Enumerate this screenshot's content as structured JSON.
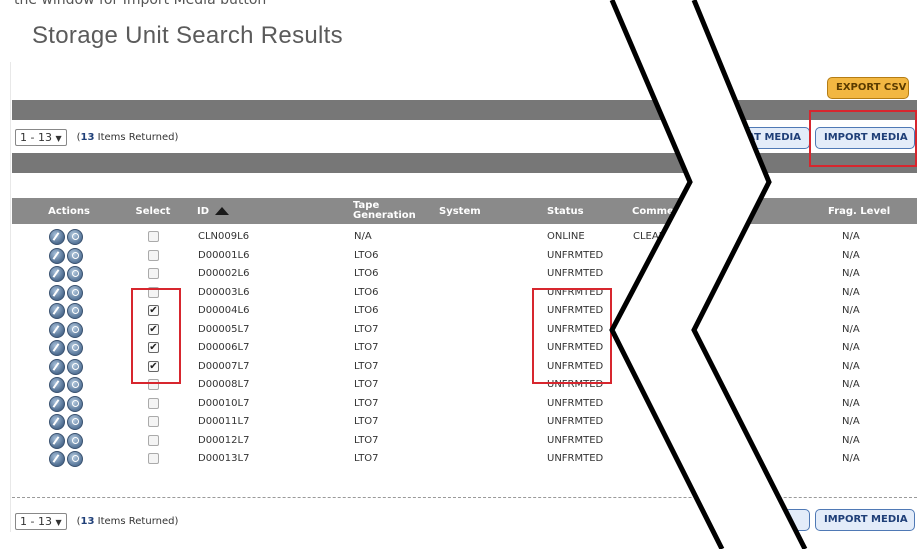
{
  "page": {
    "top_cut_text": "the window for Import Media button",
    "title": "Storage Unit Search Results"
  },
  "toolbar": {
    "export_csv": "EXPORT CSV",
    "format_media_partial": "AT MEDIA",
    "import_media": "IMPORT MEDIA"
  },
  "pager": {
    "range_label": "1 - 13",
    "arrow": "▼",
    "count_prefix": "(",
    "count": "13",
    "count_suffix": " Items Returned)"
  },
  "table": {
    "columns": {
      "actions": "Actions",
      "select": "Select",
      "id": "ID",
      "tape_generation": "Tape Generation",
      "system": "System",
      "status": "Status",
      "comments_partial": "Comme",
      "frag_level": "Frag. Level"
    },
    "sort_column": "id",
    "rows": [
      {
        "id": "CLN009L6",
        "tape_generation": "N/A",
        "system": "",
        "status": "ONLINE",
        "comments": "CLEANING",
        "frag_level": "N/A",
        "selected": false
      },
      {
        "id": "D00001L6",
        "tape_generation": "LTO6",
        "system": "",
        "status": "UNFRMTED",
        "comments": "",
        "frag_level": "N/A",
        "selected": false
      },
      {
        "id": "D00002L6",
        "tape_generation": "LTO6",
        "system": "",
        "status": "UNFRMTED",
        "comments": "",
        "frag_level": "N/A",
        "selected": false
      },
      {
        "id": "D00003L6",
        "tape_generation": "LTO6",
        "system": "",
        "status": "UNFRMTED",
        "comments": "",
        "frag_level": "N/A",
        "selected": false
      },
      {
        "id": "D00004L6",
        "tape_generation": "LTO6",
        "system": "",
        "status": "UNFRMTED",
        "comments": "",
        "frag_level": "N/A",
        "selected": true
      },
      {
        "id": "D00005L7",
        "tape_generation": "LTO7",
        "system": "",
        "status": "UNFRMTED",
        "comments": "",
        "frag_level": "N/A",
        "selected": true
      },
      {
        "id": "D00006L7",
        "tape_generation": "LTO7",
        "system": "",
        "status": "UNFRMTED",
        "comments": "",
        "frag_level": "N/A",
        "selected": true
      },
      {
        "id": "D00007L7",
        "tape_generation": "LTO7",
        "system": "",
        "status": "UNFRMTED",
        "comments": "",
        "frag_level": "N/A",
        "selected": true
      },
      {
        "id": "D00008L7",
        "tape_generation": "LTO7",
        "system": "",
        "status": "UNFRMTED",
        "comments": "",
        "frag_level": "N/A",
        "selected": false
      },
      {
        "id": "D00010L7",
        "tape_generation": "LTO7",
        "system": "",
        "status": "UNFRMTED",
        "comments": "",
        "frag_level": "N/A",
        "selected": false
      },
      {
        "id": "D00011L7",
        "tape_generation": "LTO7",
        "system": "",
        "status": "UNFRMTED",
        "comments": "",
        "frag_level": "N/A",
        "selected": false
      },
      {
        "id": "D00012L7",
        "tape_generation": "LTO7",
        "system": "",
        "status": "UNFRMTED",
        "comments": "",
        "frag_level": "N/A",
        "selected": false
      },
      {
        "id": "D00013L7",
        "tape_generation": "LTO7",
        "system": "",
        "status": "UNFRMTED",
        "comments": "",
        "frag_level": "N/A",
        "selected": false
      }
    ]
  },
  "colors": {
    "header_bar": "#777777",
    "table_header": "#8a8a8a",
    "highlight": "#d7262e",
    "export_button": "#f2b742",
    "import_button": "#e3ecf9"
  },
  "icons": {
    "edit": "edit-icon",
    "view": "view-icon",
    "sort": "sort-ascending-icon",
    "dropdown": "chevron-down-icon",
    "checkmark": "checkmark-icon"
  }
}
